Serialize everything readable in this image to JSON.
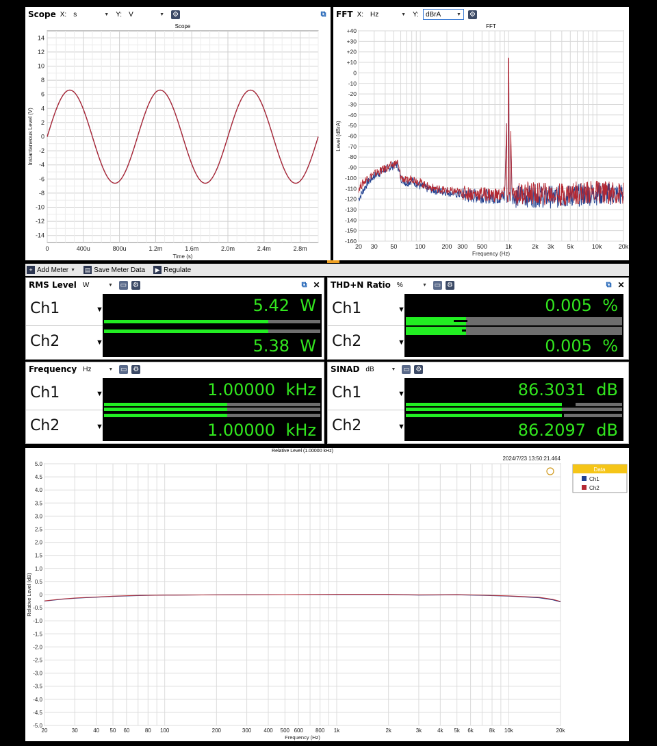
{
  "scope": {
    "title": "Scope",
    "x_label": "X:",
    "x_unit": "s",
    "y_label": "Y:",
    "y_unit": "V",
    "chart_title": "Scope",
    "xlabel": "Time (s)",
    "ylabel": "Instantaneous Level (V)",
    "x_ticks": [
      "0",
      "400u",
      "800u",
      "1.2m",
      "1.6m",
      "2.0m",
      "2.4m",
      "2.8m"
    ],
    "y_ticks": [
      "14",
      "12",
      "10",
      "8",
      "6",
      "4",
      "2",
      "0",
      "-2",
      "-4",
      "-6",
      "-8",
      "-10",
      "-12",
      "-14"
    ]
  },
  "fft": {
    "title": "FFT",
    "x_label": "X:",
    "x_unit": "Hz",
    "y_label": "Y:",
    "y_unit": "dBrA",
    "chart_title": "FFT",
    "xlabel": "Frequency (Hz)",
    "ylabel": "Level (dBrA)",
    "x_ticks": [
      "20",
      "30",
      "50",
      "100",
      "200",
      "300",
      "500",
      "1k",
      "2k",
      "3k",
      "5k",
      "10k",
      "20k"
    ],
    "y_ticks": [
      "+40",
      "+30",
      "+20",
      "+10",
      "0",
      "-10",
      "-20",
      "-30",
      "-40",
      "-50",
      "-60",
      "-70",
      "-80",
      "-90",
      "-100",
      "-110",
      "-120",
      "-130",
      "-140",
      "-150",
      "-160"
    ]
  },
  "toolbar": {
    "add_meter": "Add Meter",
    "save_meter_data": "Save Meter Data",
    "regulate": "Regulate"
  },
  "meters": {
    "rms": {
      "title": "RMS Level",
      "unit": "W",
      "ch1_label": "Ch1",
      "ch2_label": "Ch2",
      "ch1_value": "5.42",
      "ch2_value": "5.38",
      "ch1_unit": "W",
      "ch2_unit": "W"
    },
    "thdn": {
      "title": "THD+N Ratio",
      "unit": "%",
      "ch1_label": "Ch1",
      "ch2_label": "Ch2",
      "ch1_value": "0.005",
      "ch2_value": "0.005",
      "ch1_unit": "%",
      "ch2_unit": "%"
    },
    "freq": {
      "title": "Frequency",
      "unit": "Hz",
      "ch1_label": "Ch1",
      "ch2_label": "Ch2",
      "ch1_value": "1.00000",
      "ch2_value": "1.00000",
      "ch1_unit": "kHz",
      "ch2_unit": "kHz"
    },
    "sinad": {
      "title": "SINAD",
      "unit": "dB",
      "ch1_label": "Ch1",
      "ch2_label": "Ch2",
      "ch1_value": "86.3031",
      "ch2_value": "86.2097",
      "ch1_unit": "dB",
      "ch2_unit": "dB"
    }
  },
  "colors": {
    "ch1": "#1f3f8f",
    "ch2": "#b42832",
    "meter_text": "#32e61e"
  },
  "chart_data": [
    {
      "type": "line",
      "title": "Scope",
      "xlabel": "Time (s)",
      "ylabel": "Instantaneous Level (V)",
      "xlim": [
        0,
        0.003
      ],
      "ylim": [
        -15,
        15
      ],
      "series": [
        {
          "name": "Ch1",
          "amplitude": 6.6,
          "frequency": 1000,
          "phase_deg": 0
        },
        {
          "name": "Ch2",
          "amplitude": 6.6,
          "frequency": 1000,
          "phase_deg": 0
        }
      ],
      "grid": true
    },
    {
      "type": "line",
      "title": "FFT",
      "xlabel": "Frequency (Hz)",
      "ylabel": "Level (dBrA)",
      "xscale": "log",
      "xlim": [
        20,
        20000
      ],
      "ylim": [
        -160,
        40
      ],
      "series": [
        {
          "name": "Ch1",
          "x": [
            20,
            25,
            30,
            40,
            50,
            55,
            60,
            70,
            80,
            100,
            120,
            150,
            200,
            250,
            300,
            400,
            500,
            700,
            900,
            1000,
            1100,
            1500,
            2000,
            3000,
            4000,
            5000,
            7000,
            10000,
            15000,
            20000
          ],
          "y": [
            -120,
            -105,
            -98,
            -92,
            -88,
            -87,
            -100,
            -105,
            -102,
            -108,
            -110,
            -112,
            -113,
            -115,
            -116,
            -117,
            -117,
            -118,
            -118,
            14,
            -118,
            -117,
            -117,
            -118,
            -118,
            -117,
            -116,
            -115,
            -115,
            -116
          ]
        },
        {
          "name": "Ch2",
          "x": [
            20,
            25,
            30,
            40,
            50,
            55,
            60,
            70,
            80,
            100,
            120,
            150,
            200,
            250,
            300,
            400,
            500,
            700,
            900,
            1000,
            1100,
            1500,
            2000,
            3000,
            4000,
            5000,
            7000,
            10000,
            15000,
            20000
          ],
          "y": [
            -110,
            -100,
            -96,
            -91,
            -87,
            -85,
            -99,
            -103,
            -100,
            -104,
            -108,
            -110,
            -112,
            -113,
            -114,
            -115,
            -115,
            -116,
            -116,
            14,
            -116,
            -114,
            -115,
            -115,
            -116,
            -114,
            -114,
            -113,
            -114,
            -115
          ]
        }
      ],
      "grid": true
    },
    {
      "type": "line",
      "title": "Relative Level (1.00000 kHz)",
      "timestamp": "2024/7/23 13:50:21.464",
      "xlabel": "Frequency (Hz)",
      "ylabel": "Relative Level (dB)",
      "xscale": "log",
      "xlim": [
        20,
        20000
      ],
      "ylim": [
        -5,
        5
      ],
      "x_ticks": [
        "20",
        "30",
        "40",
        "50",
        "60",
        "80",
        "100",
        "200",
        "300",
        "400",
        "500",
        "600",
        "800",
        "1k",
        "2k",
        "3k",
        "4k",
        "5k",
        "6k",
        "8k",
        "10k",
        "20k"
      ],
      "y_ticks": [
        "5.0",
        "4.5",
        "4.0",
        "3.5",
        "3.0",
        "2.5",
        "2.0",
        "1.5",
        "1.0",
        "0.5",
        "0",
        "-0.5",
        "-1.0",
        "-1.5",
        "-2.0",
        "-2.5",
        "-3.0",
        "-3.5",
        "-4.0",
        "-4.5",
        "-5.0"
      ],
      "legend": {
        "title": "Data",
        "placement": "top-right",
        "entries": [
          "Ch1",
          "Ch2"
        ]
      },
      "series": [
        {
          "name": "Ch1",
          "x": [
            20,
            25,
            30,
            40,
            50,
            70,
            100,
            200,
            500,
            1000,
            2000,
            3000,
            5000,
            7000,
            10000,
            15000,
            18000,
            20000
          ],
          "y": [
            -0.25,
            -0.18,
            -0.14,
            -0.1,
            -0.07,
            -0.04,
            -0.02,
            -0.01,
            0.0,
            0.0,
            0.0,
            -0.02,
            -0.01,
            -0.03,
            -0.06,
            -0.12,
            -0.2,
            -0.28
          ]
        },
        {
          "name": "Ch2",
          "x": [
            20,
            25,
            30,
            40,
            50,
            70,
            100,
            200,
            500,
            1000,
            2000,
            3000,
            5000,
            7000,
            10000,
            15000,
            18000,
            20000
          ],
          "y": [
            -0.24,
            -0.17,
            -0.13,
            -0.09,
            -0.06,
            -0.03,
            -0.02,
            -0.01,
            0.0,
            0.01,
            0.01,
            -0.01,
            0.0,
            -0.02,
            -0.05,
            -0.1,
            -0.18,
            -0.26
          ]
        }
      ],
      "grid": true
    }
  ]
}
